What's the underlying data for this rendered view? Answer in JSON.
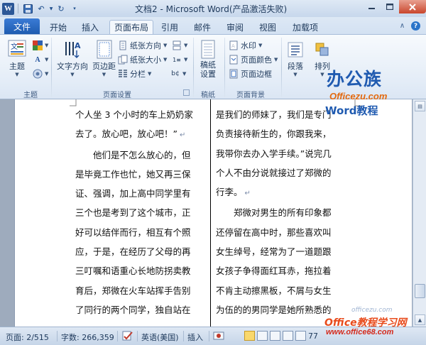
{
  "title_bar": {
    "title": "文档2 - Microsoft Word(产品激活失败)",
    "app_icon_letter": "W"
  },
  "tabs": {
    "file": "文件",
    "items": [
      "开始",
      "插入",
      "页面布局",
      "引用",
      "邮件",
      "审阅",
      "视图",
      "加载项"
    ],
    "active": "页面布局"
  },
  "ribbon": {
    "theme_group": {
      "label": "主题",
      "theme_button": "主题"
    },
    "page_setup_group": {
      "label": "页面设置",
      "text_direction": "文字方向",
      "margins": "页边距",
      "orientation": "纸张方向",
      "size": "纸张大小",
      "columns": "分栏"
    },
    "draft_group": {
      "label": "稿纸",
      "draft_settings": "稿纸\n设置"
    },
    "background_group": {
      "label": "页面背景",
      "watermark": "水印",
      "page_color": "页面颜色",
      "page_borders": "页面边框"
    },
    "paragraph": "段落",
    "arrange": "排列"
  },
  "logo": {
    "cn": "办公族",
    "en": "Officezu.com",
    "sub": "Word教程"
  },
  "document": {
    "left_column": [
      "个人坐 3 个小时的车上奶奶家",
      "去了。放心吧，放心吧！”",
      "　　他们是不怎么放心的，但",
      "是毕竟工作也忙，她又再三保",
      "证、强调，加上高中同学里有",
      "三个也是考到了这个城市，正",
      "好可以结伴而行，相互有个照",
      "应，于是，在经历了父母的再",
      "三叮嘱和语重心长地防拐卖教",
      "育后，郑微在火车站挥手告别",
      "了同行的两个同学，独自站在"
    ],
    "right_column": [
      "是我们的师妹了，我们是专门",
      "负责接待新生的，你跟我来，",
      "我带你去办入学手续。”说完几",
      "个人不由分说就接过了郑微的",
      "行李。",
      "　　郑微对男生的所有印象都",
      "还停留在高中时，那些喜欢叫",
      "女生绰号，经常为了一道题跟",
      "女孩子争得面红耳赤，拖拉着",
      "不肯主动擦黑板，不屑与女生",
      "为伍的的男同学是她所熟悉的"
    ]
  },
  "status_bar": {
    "page": "页面: 2/515",
    "words": "字数: 266,359",
    "language": "英语(美国)",
    "insert_mode": "插入",
    "zoom": "77"
  },
  "site_watermark": {
    "small": "officezu.com",
    "main": "Office教程学习网",
    "url": "www.office68.com"
  }
}
